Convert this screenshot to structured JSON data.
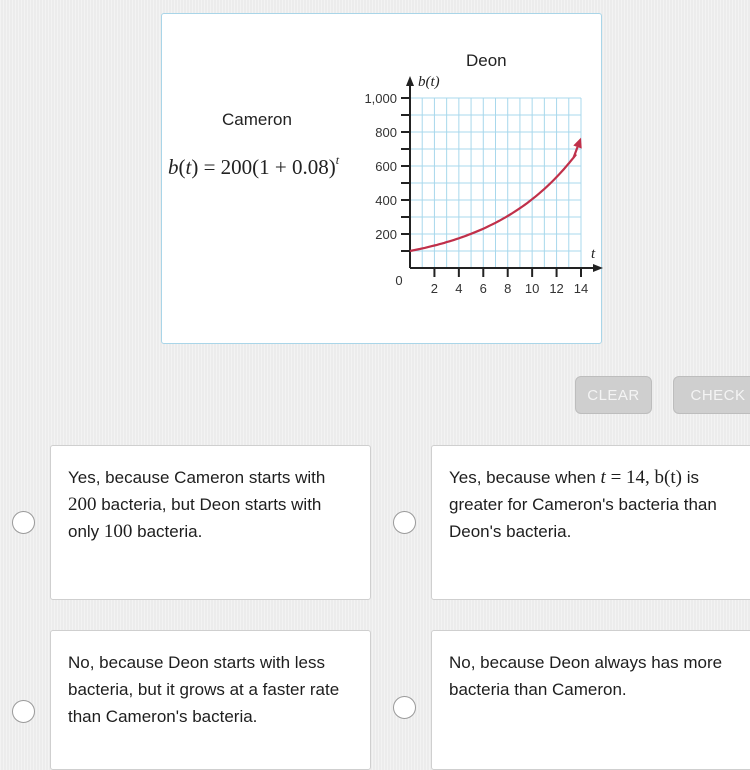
{
  "problem": {
    "cameron": {
      "title": "Cameron",
      "formula_prefix": "b(",
      "formula_var": "t",
      "formula_mid": ") = 200(1 + 0.08)",
      "formula_exponent": "t"
    },
    "deon": {
      "title": "Deon"
    }
  },
  "chart_data": {
    "type": "line",
    "title": "Deon",
    "xlabel": "t",
    "ylabel": "b(t)",
    "xlim": [
      0,
      14
    ],
    "ylim": [
      0,
      1000
    ],
    "x_ticks": [
      2,
      4,
      6,
      8,
      10,
      12,
      14
    ],
    "x_tick_labels": [
      "2",
      "4",
      "6",
      "8",
      "10",
      "12",
      "14"
    ],
    "y_ticks": [
      200,
      400,
      600,
      800,
      1000
    ],
    "y_tick_labels": [
      "200",
      "400",
      "600",
      "800",
      "1,000"
    ],
    "origin_label": "0",
    "grid": true,
    "series": [
      {
        "name": "Deon b(t)",
        "color": "#c0304a",
        "x": [
          0,
          2,
          4,
          6,
          8,
          10,
          12,
          14
        ],
        "y": [
          100,
          132,
          175,
          231,
          306,
          405,
          535,
          708
        ]
      }
    ]
  },
  "buttons": {
    "clear": "CLEAR",
    "check": "CHECK"
  },
  "answers": [
    {
      "parts": [
        "Yes, because Cameron starts with ",
        "200",
        " bacteria, but Deon starts with only ",
        "100",
        " bacteria."
      ]
    },
    {
      "parts": [
        "Yes, because when ",
        "t",
        " = 14, ",
        "b(t)",
        " is greater for Cameron's bacteria than Deon's bacteria."
      ]
    },
    {
      "parts": [
        "No, because Deon starts with less bacteria, but it grows at a faster rate than Cameron's bacteria."
      ]
    },
    {
      "parts": [
        "No, because Deon always has more bacteria than Cameron."
      ]
    }
  ],
  "colors": {
    "grid": "#a8d8ec",
    "curve": "#c0304a",
    "card_border": "#a9d5e8"
  }
}
